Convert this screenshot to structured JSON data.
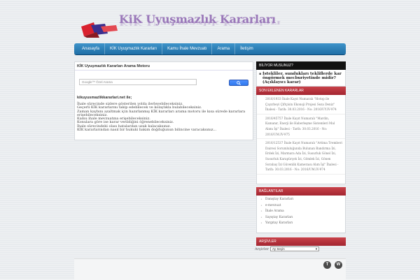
{
  "header": {
    "logo_title": "KiK Uyuşmazlık Kararları"
  },
  "nav": {
    "items": [
      "Anasayfa",
      "KİK Uyuşmazlık Kararları",
      "Kamu İhale Mevzuatı",
      "Arama",
      "İletişim"
    ]
  },
  "main": {
    "title": "KİK Uyuşmazlık Kararları Arama Motoru",
    "search_placeholder": "Google™ Özel Arama",
    "site_heading": "kikuyusmazlikkararlari.net ile;",
    "description": [
      "İhale sürecinde sizlere gösterilen yolda ilerleyebileceksiniz.",
      "Geçerli KİK kararlarını takip edebilecek ve kolaylıkla bulabileceksiniz.",
      "Zaman kaybını azaltmak için hazırlanmış KİK kararları arama motoru ile kısa sürede kararlara",
      "erişebileceksiniz.",
      "Kamu ihale mevzuatına erişebileceksiniz.",
      "Konulara göre ise karar verildiğini öğrenebileceksiniz.",
      "İhale sürecindeki olası hatalardan uzak kalacaksınız.",
      "KİK kararlarından nasıl bir hukuki bakım doğduğunun bilincine varacaksınız..."
    ]
  },
  "sidebar": {
    "bilgi": {
      "title": "BİLİYOR MUSUNUZ?",
      "text": "İstekliler, sundukları tekliflerde kar öngörmek mecburiyetinde midir? (Açıklayıcı karar)"
    },
    "news": {
      "title": "SON EKLENEN KARARLAR",
      "items": [
        "2016/1933 İhale Kayıt Numaralı \"Hotop ile Çayırbeyi Çiftçisin Ekonoji Projesi Seza Deniz\" İhalesi - Tarih: 30.03.2016 - No: 2016/UY.IV-974",
        "2016/45757 İhale Kayıt Numaralı \"Mardin, Kamanır, Enerji ile Haberleşme Sistemleri Mal Alımı İşi\" İhalesi - Tarih: 30.03.2016 - No: 2016/UM.IV-975",
        "2016/12537 İhale Kayıt Numaralı \"Artima Tremberi Dairesi Sorumluluğunda Bulunan Bandırma İzi, Erdek İzi, Marmara Ada İzi, Susurluk Gönel İzi, Susurluk Karapürçek İzi, Gömlek İzi, Gönen Sorabay İzi Güvenlik Kameraısı Alım İşi\" İhalesi - Tarih: 30.03.2016 - No: 2016/UM.IV-974"
      ]
    },
    "links": {
      "title": "BAĞLANTILAR",
      "items": [
        "Danıştay Kararları",
        "e-mevzuat",
        "İhale Arama",
        "Sayıştay Kararları",
        "Yargıtay Kararları"
      ]
    },
    "arsiv": {
      "title": "ARŞİVLER",
      "label": "Arşivler",
      "select_value": "Ay Seçin"
    }
  },
  "footer": {
    "social": [
      "T",
      "W"
    ]
  }
}
